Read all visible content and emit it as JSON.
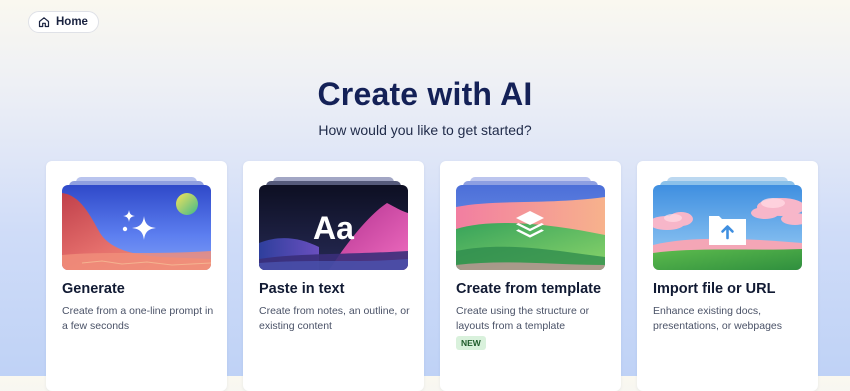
{
  "nav": {
    "home_label": "Home"
  },
  "header": {
    "title": "Create with AI",
    "subtitle": "How would you like to get started?"
  },
  "cards": [
    {
      "title": "Generate",
      "description": "Create from a one-line prompt in a few seconds",
      "thumb_icon": "sparkle-icon"
    },
    {
      "title": "Paste in text",
      "description": "Create from notes, an outline, or existing content",
      "thumb_text": "Aa"
    },
    {
      "title": "Create from template",
      "description": "Create using the structure or layouts from a template",
      "badge": "NEW",
      "thumb_icon": "layers-icon"
    },
    {
      "title": "Import file or URL",
      "description": "Enhance existing docs, presentations, or webpages",
      "thumb_icon": "upload-folder-icon"
    }
  ],
  "colors": {
    "title": "#142157",
    "badge_bg": "#d9f1dc",
    "badge_text": "#1e5b2a"
  }
}
